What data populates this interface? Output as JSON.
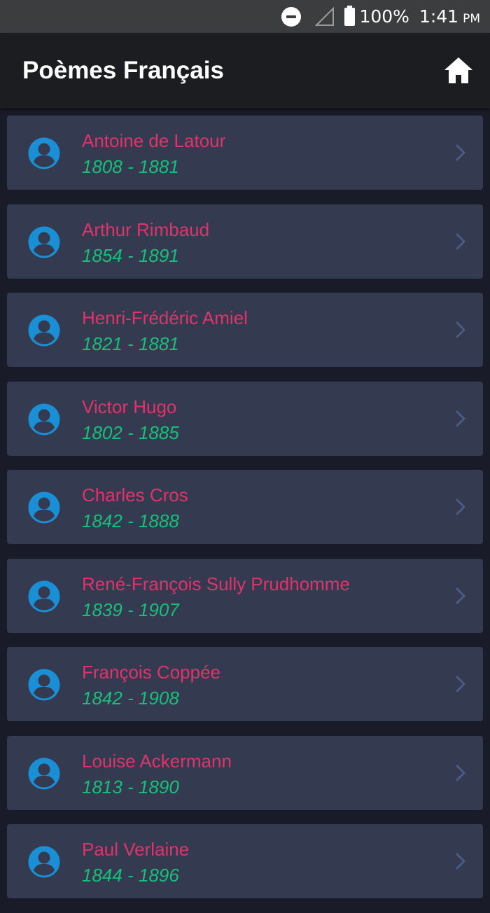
{
  "status_bar": {
    "battery": "100%",
    "time": "1:41",
    "ampm": "PM"
  },
  "header": {
    "title": "Poèmes Français",
    "home_icon": "home-icon"
  },
  "colors": {
    "accent_name": "#e0336b",
    "accent_dates": "#16c07a",
    "avatar": "#1a8fd6",
    "card_bg": "#343a4f",
    "page_bg": "#191c28"
  },
  "poets": [
    {
      "name": "Antoine de Latour",
      "dates": "1808 - 1881"
    },
    {
      "name": "Arthur Rimbaud",
      "dates": "1854 - 1891"
    },
    {
      "name": "Henri-Frédéric Amiel",
      "dates": "1821 - 1881"
    },
    {
      "name": "Victor Hugo",
      "dates": "1802 - 1885"
    },
    {
      "name": "Charles Cros",
      "dates": "1842 - 1888"
    },
    {
      "name": "René-François Sully Prudhomme",
      "dates": "1839 - 1907"
    },
    {
      "name": "François Coppée",
      "dates": "1842 - 1908"
    },
    {
      "name": "Louise Ackermann",
      "dates": "1813 - 1890"
    },
    {
      "name": "Paul Verlaine",
      "dates": "1844 - 1896"
    }
  ]
}
